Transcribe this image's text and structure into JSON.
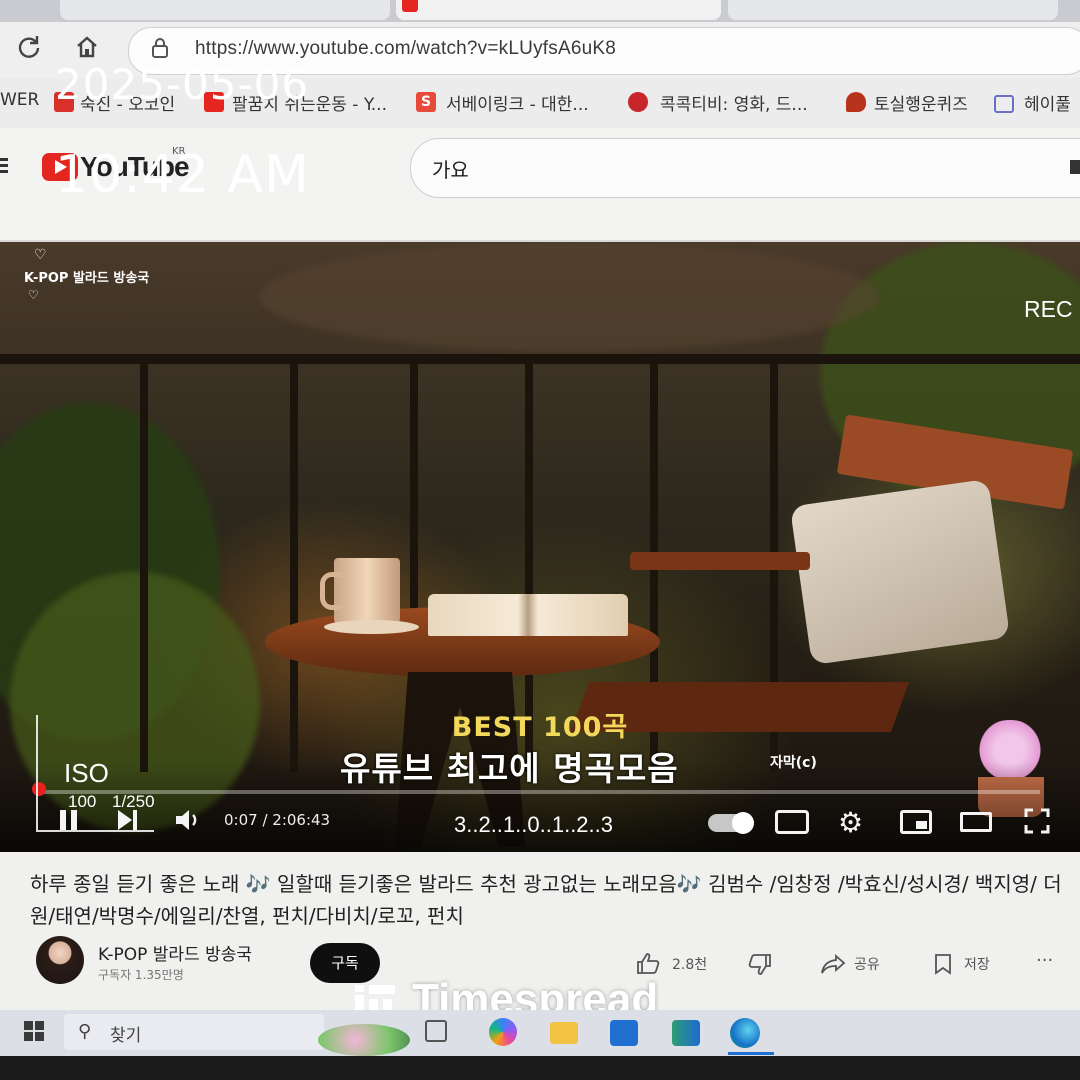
{
  "camera_overlay": {
    "date": "2025-05-06",
    "time": "10:42 AM",
    "rec": "REC",
    "iso": "ISO",
    "iso_value": "100",
    "shutter": "1/250",
    "exposure_scale": "3..2..1..0..1..2..3"
  },
  "browser": {
    "url": "https://www.youtube.com/watch?v=kLUyfsA6uK8",
    "bookmarks": [
      {
        "label": "WER",
        "icon": "none"
      },
      {
        "label": "숙진 - 오코인",
        "icon": "red-square-icon"
      },
      {
        "label": "팔꿈치 쉬는운동 - Y...",
        "icon": "youtube-icon"
      },
      {
        "label": "서베이링크 - 대한...",
        "icon": "s-logo-icon"
      },
      {
        "label": "콕콕티비: 영화, 드...",
        "icon": "film-icon"
      },
      {
        "label": "토실행운퀴즈",
        "icon": "drumstick-icon"
      },
      {
        "label": "헤이풀",
        "icon": "chain-icon"
      }
    ]
  },
  "youtube": {
    "logo_text": "YouTube",
    "region": "KR",
    "search_value": "가요"
  },
  "video": {
    "channel_overlay": "K-POP 발라드 방송국",
    "best_title": "BEST 100곡",
    "main_title": "유튜브 최고에 명곡모음",
    "subtitle_tag": "자막(c)",
    "time_display": "0:07 / 2:06:43",
    "progress_fraction": 0.0009
  },
  "watch": {
    "title": "하루 종일 듣기 좋은 노래 🎶 일할때 듣기좋은 발라드 추천 광고없는 노래모음🎶 김범수 /임창정 /박효신/성시경/ 백지영/ 더원/태연/박명수/에일리/찬열, 펀치/다비치/로꼬, 펀치",
    "channel_name": "K-POP 발라드 방송국",
    "subscribers": "구독자 1.35만명",
    "subscribe_label": "구독",
    "likes": "2.8천",
    "share_label": "공유",
    "save_label": "저장",
    "more": "···"
  },
  "watermark": "Timespread",
  "taskbar": {
    "search_placeholder": "찾기"
  }
}
